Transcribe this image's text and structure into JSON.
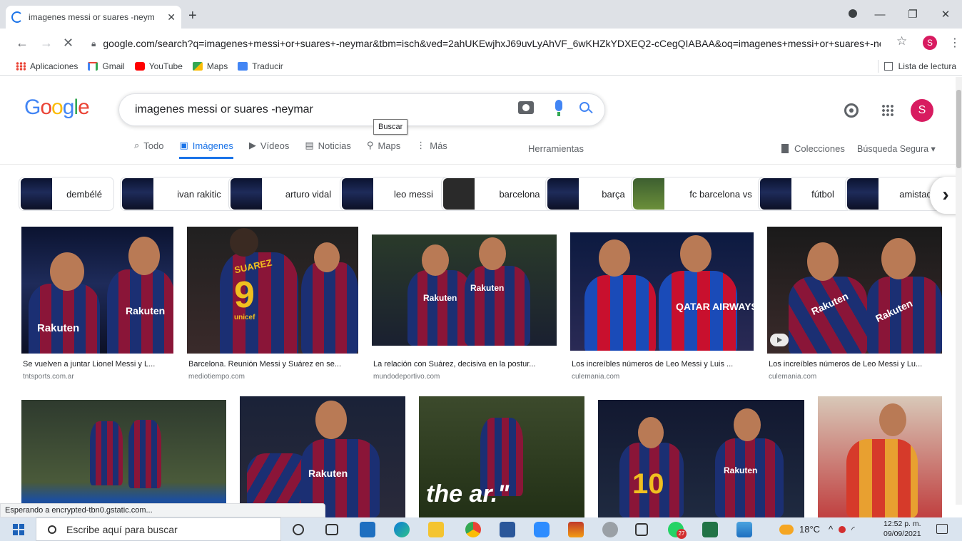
{
  "browser": {
    "tab_title": "imagenes messi or suares -neym",
    "url": "google.com/search?q=imagenes+messi+or+suares+-neymar&tbm=isch&ved=2ahUKEwjhxJ69uvLyAhVF_6wKHZkYDXEQ2-cCegQIABAA&oq=imagenes+messi+or+suares+-ney...",
    "profile_initial": "S",
    "bookmarks": [
      "Aplicaciones",
      "Gmail",
      "YouTube",
      "Maps",
      "Traducir"
    ],
    "reading_list": "Lista de lectura"
  },
  "google": {
    "query": "imagenes messi or suares -neymar",
    "search_tooltip": "Buscar",
    "avatar_initial": "S",
    "tabs": [
      "Todo",
      "Imágenes",
      "Vídeos",
      "Noticias",
      "Maps",
      "Más"
    ],
    "tools": "Herramientas",
    "collections": "Colecciones",
    "safe_search": "Búsqueda Segura ▾",
    "chips": [
      "dembélé",
      "ivan rakitic",
      "arturo vidal",
      "leo messi",
      "barcelona",
      "barça",
      "fc barcelona vs",
      "fútbol",
      "amistad"
    ],
    "results": [
      {
        "caption": "Se vuelven a juntar Lionel Messi y L...",
        "source": "tntsports.com.ar"
      },
      {
        "caption": "Barcelona. Reunión Messi y Suárez en se...",
        "source": "mediotiempo.com"
      },
      {
        "caption": "La relación con Suárez, decisiva en la postur...",
        "source": "mundodeportivo.com"
      },
      {
        "caption": "Los increíbles números de Leo Messi y Luis ...",
        "source": "culemania.com"
      },
      {
        "caption": "Los increíbles números de Leo Messi y Lu...",
        "source": "culemania.com"
      }
    ],
    "image_text": {
      "sponsor": "Rakuten",
      "sponsor_alt": "QATAR AIRWAYS",
      "suarez_name": "SUAREZ",
      "suarez_number": "9",
      "messi_number": "10",
      "stadium_text": "the  ar.\"",
      "unicef": "unicef"
    }
  },
  "status": "Esperando a encrypted-tbn0.gstatic.com...",
  "taskbar": {
    "search_placeholder": "Escribe aquí para buscar",
    "weather": "18°C",
    "time": "12:52 p. m.",
    "date": "09/09/2021",
    "whatsapp_badge": "27"
  }
}
